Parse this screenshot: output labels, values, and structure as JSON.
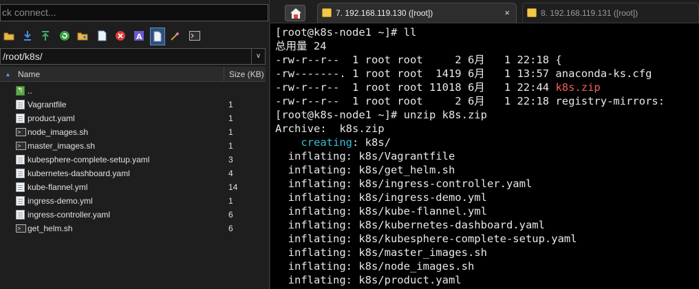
{
  "left": {
    "connect_text": "ck connect...",
    "path": "/root/k8s/",
    "columns": {
      "name": "Name",
      "size": "Size (KB)"
    },
    "toolbar": [
      {
        "icon": "folder-icon"
      },
      {
        "icon": "download-icon"
      },
      {
        "icon": "upload-icon"
      },
      {
        "icon": "refresh-icon"
      },
      {
        "icon": "new-folder-icon"
      },
      {
        "icon": "new-file-icon"
      },
      {
        "icon": "delete-icon"
      },
      {
        "icon": "rename-icon"
      },
      {
        "icon": "properties-icon"
      },
      {
        "icon": "magic-wand-icon"
      },
      {
        "icon": "terminal-icon"
      }
    ],
    "files": [
      {
        "name": "..",
        "size": "",
        "icon": "up"
      },
      {
        "name": "Vagrantfile",
        "size": "1",
        "icon": "doc"
      },
      {
        "name": "product.yaml",
        "size": "1",
        "icon": "doc"
      },
      {
        "name": "node_images.sh",
        "size": "1",
        "icon": "sh"
      },
      {
        "name": "master_images.sh",
        "size": "1",
        "icon": "sh"
      },
      {
        "name": "kubesphere-complete-setup.yaml",
        "size": "3",
        "icon": "doc"
      },
      {
        "name": "kubernetes-dashboard.yaml",
        "size": "4",
        "icon": "doc"
      },
      {
        "name": "kube-flannel.yml",
        "size": "14",
        "icon": "doc"
      },
      {
        "name": "ingress-demo.yml",
        "size": "1",
        "icon": "doc"
      },
      {
        "name": "ingress-controller.yaml",
        "size": "6",
        "icon": "doc"
      },
      {
        "name": "get_helm.sh",
        "size": "6",
        "icon": "sh"
      }
    ]
  },
  "tabs": {
    "active": "7. 192.168.119.130 ([root])",
    "inactive": "8. 192.168.119.131 ([root])",
    "close": "×"
  },
  "terminal": {
    "lines": [
      [
        {
          "t": "[root@k8s-node1 ~]# ll"
        }
      ],
      [
        {
          "t": "总用量 24"
        }
      ],
      [
        {
          "t": "-rw-r--r--  1 root root     2 6月   1 22:18 {"
        }
      ],
      [
        {
          "t": "-rw-------. 1 root root  1419 6月   1 13:57 anaconda-ks.cfg"
        }
      ],
      [
        {
          "t": "-rw-r--r--  1 root root 11018 6月   1 22:44 "
        },
        {
          "t": "k8s.zip",
          "c": "red"
        }
      ],
      [
        {
          "t": "-rw-r--r--  1 root root     2 6月   1 22:18 registry-mirrors:"
        }
      ],
      [
        {
          "t": "[root@k8s-node1 ~]# unzip k8s.zip"
        }
      ],
      [
        {
          "t": "Archive:  k8s.zip"
        }
      ],
      [
        {
          "t": "    "
        },
        {
          "t": "creating",
          "c": "cyan"
        },
        {
          "t": ": k8s/"
        }
      ],
      [
        {
          "t": "  inflating: k8s/Vagrantfile"
        }
      ],
      [
        {
          "t": "  inflating: k8s/get_helm.sh"
        }
      ],
      [
        {
          "t": "  inflating: k8s/ingress-controller.yaml"
        }
      ],
      [
        {
          "t": "  inflating: k8s/ingress-demo.yml"
        }
      ],
      [
        {
          "t": "  inflating: k8s/kube-flannel.yml"
        }
      ],
      [
        {
          "t": "  inflating: k8s/kubernetes-dashboard.yaml"
        }
      ],
      [
        {
          "t": "  inflating: k8s/kubesphere-complete-setup.yaml"
        }
      ],
      [
        {
          "t": "  inflating: k8s/master_images.sh"
        }
      ],
      [
        {
          "t": "  inflating: k8s/node_images.sh"
        }
      ],
      [
        {
          "t": "  inflating: k8s/product.yaml"
        }
      ]
    ]
  },
  "colors": {
    "error_file": "#f06060",
    "creating": "#36bfd8",
    "accent_sort": "#5b8ee6"
  }
}
